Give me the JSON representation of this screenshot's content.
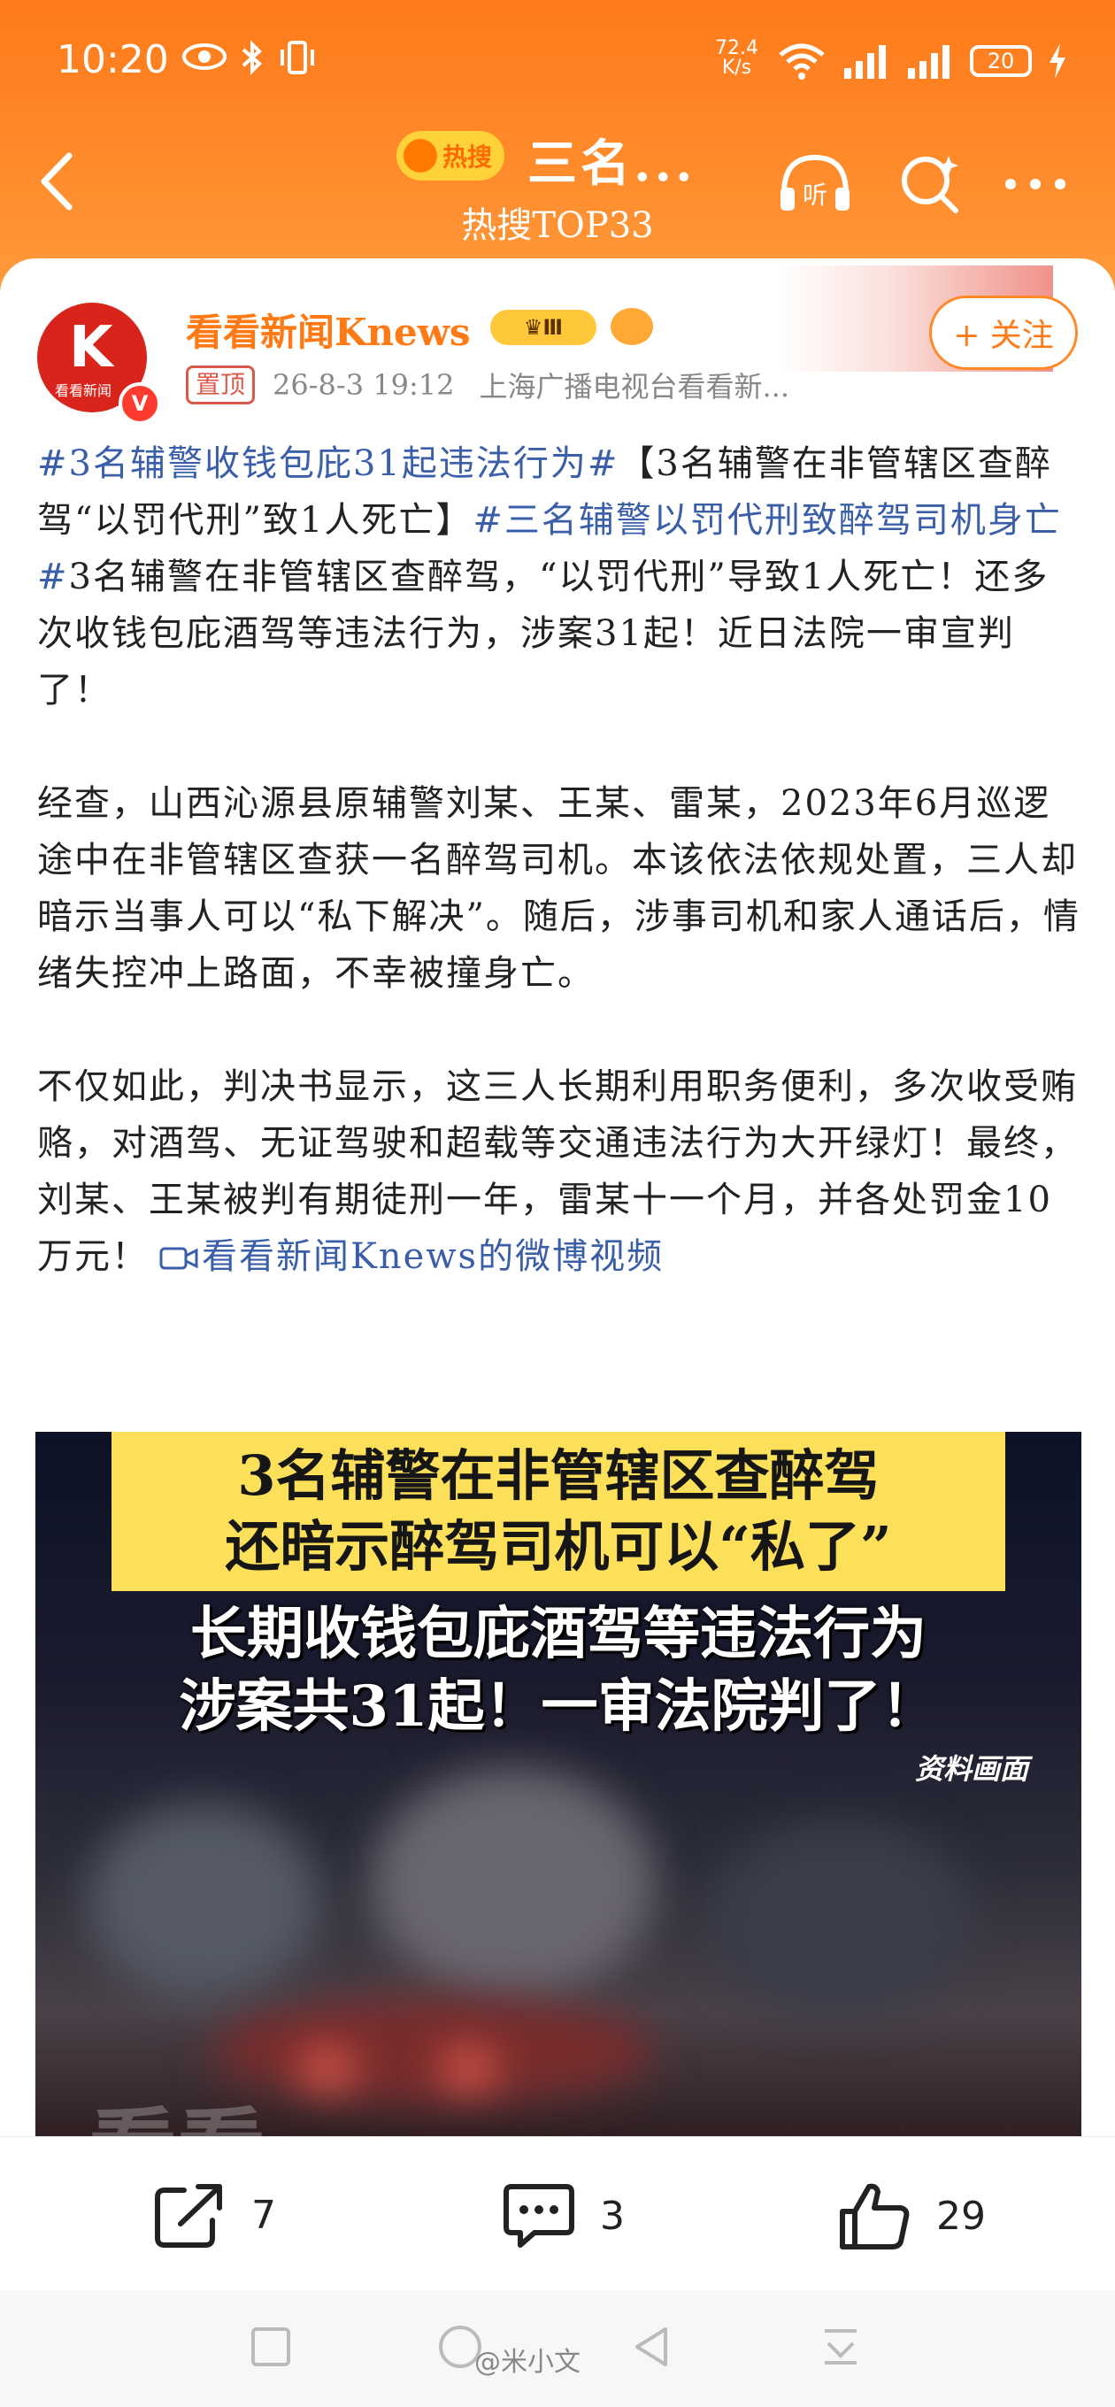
{
  "status_bar": {
    "time": "10:20",
    "speed_value": "72.4",
    "speed_unit": "K/s",
    "battery": "20"
  },
  "nav": {
    "hot_label": "热搜",
    "title": "三名...",
    "subtitle": "热搜TOP33"
  },
  "post": {
    "author": "看看新闻Knews",
    "level": "Ⅲ",
    "follow_label": "+ 关注",
    "pinned_label": "置顶",
    "date": "26-8-3 19:12",
    "source": "上海广播电视台看看新...",
    "avatar_text": "K",
    "avatar_subtext": "看看新闻",
    "verified_mark": "V",
    "p1": {
      "tag1": "#3名辅警收钱包庇31起违法行为#",
      "text1": "【3名辅警在非管辖区查醉驾“以罚代刑”致1人死亡】",
      "tag2": "#三名辅警以罚代刑致醉驾司机身亡#",
      "text2": "3名辅警在非管辖区查醉驾，“以罚代刑”导致1人死亡！还多次收钱包庇酒驾等违法行为，涉案31起！近日法院一审宣判了！"
    },
    "p2": "经查，山西沁源县原辅警刘某、王某、雷某，2023年6月巡逻途中在非管辖区查获一名醉驾司机。本该依法依规处置，三人却暗示当事人可以“私下解决”。随后，涉事司机和家人通话后，情绪失控冲上路面，不幸被撞身亡。",
    "p3": {
      "text": "不仅如此，判决书显示，这三人长期利用职务便利，多次收受贿赂，对酒驾、无证驾驶和超载等交通违法行为大开绿灯！最终，刘某、王某被判有期徒刑一年，雷某十一个月，并各处罚金10万元！",
      "video_link": "看看新闻Knews的微博视频"
    },
    "media": {
      "banner_line1": "3名辅警在非管辖区查醉驾",
      "banner_line2": "还暗示醉驾司机可以“私了”",
      "caption_line1": "长期收钱包庇酒驾等违法行为",
      "caption_line2": "涉案共31起！一审法院判了！",
      "ref_label": "资料画面",
      "watermark": "看看"
    }
  },
  "actions": {
    "share_count": "7",
    "comment_count": "3",
    "like_count": "29"
  },
  "watermark_user": "@米小文",
  "colors": {
    "accent": "#ff7a14",
    "topic": "#3a5fa8",
    "banner": "#fde05a"
  }
}
